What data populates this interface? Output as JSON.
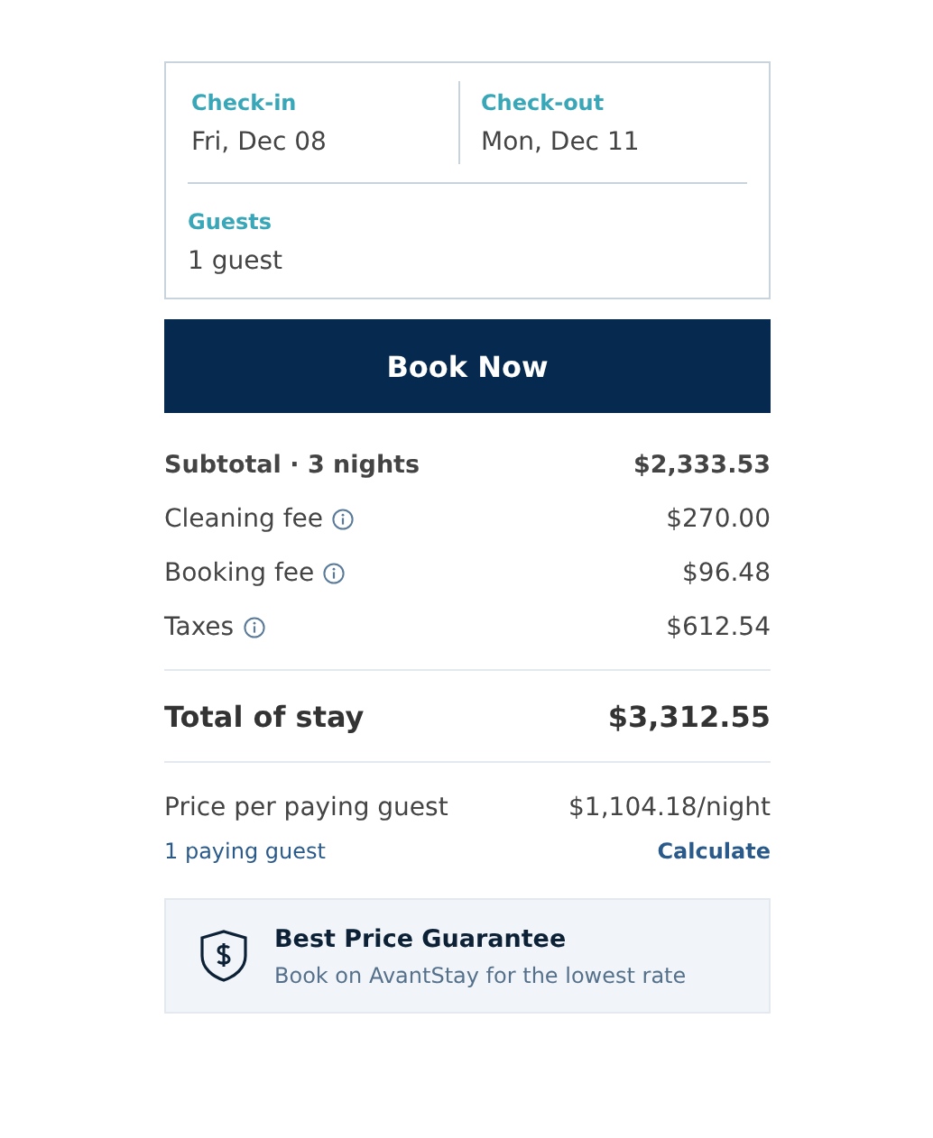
{
  "booking": {
    "check_in": {
      "label": "Check-in",
      "value": "Fri, Dec 08"
    },
    "check_out": {
      "label": "Check-out",
      "value": "Mon, Dec 11"
    },
    "guests": {
      "label": "Guests",
      "value": "1 guest"
    }
  },
  "book_button": "Book Now",
  "charges": [
    {
      "label": "Subtotal · 3 nights",
      "amount": "$2,333.53",
      "kind": "subtotal",
      "info": false
    },
    {
      "label": "Cleaning fee",
      "amount": "$270.00",
      "kind": "fee",
      "info": true
    },
    {
      "label": "Booking fee",
      "amount": "$96.48",
      "kind": "fee",
      "info": true
    },
    {
      "label": "Taxes",
      "amount": "$612.54",
      "kind": "fee",
      "info": true
    }
  ],
  "total": {
    "label": "Total of stay",
    "amount": "$3,312.55"
  },
  "per_guest": {
    "label": "Price per paying guest",
    "amount": "$1,104.18/night",
    "guests_link": "1 paying guest",
    "calculate_link": "Calculate"
  },
  "guarantee": {
    "title": "Best Price Guarantee",
    "text": "Book on AvantStay for the lowest rate"
  }
}
